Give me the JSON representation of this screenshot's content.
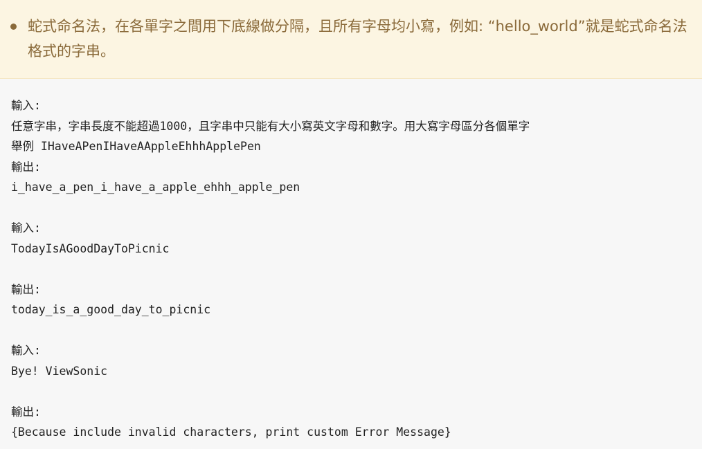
{
  "note": {
    "text": "蛇式命名法，在各單字之間用下底線做分隔，且所有字母均小寫，例如: “hello_world”就是蛇式命名法格式的字串。"
  },
  "code_lines": [
    "輸入:",
    "任意字串，字串長度不能超過1000，且字串中只能有大小寫英文字母和數字。用大寫字母區分各個單字",
    "舉例 IHaveAPenIHaveAAppleEhhhApplePen",
    "輸出:",
    "i_have_a_pen_i_have_a_apple_ehhh_apple_pen",
    "",
    "輸入:",
    "TodayIsAGoodDayToPicnic",
    "",
    "輸出:",
    "today_is_a_good_day_to_picnic",
    "",
    "輸入:",
    "Bye! ViewSonic",
    "",
    "輸出:",
    "{Because include invalid characters, print custom Error Message}"
  ]
}
